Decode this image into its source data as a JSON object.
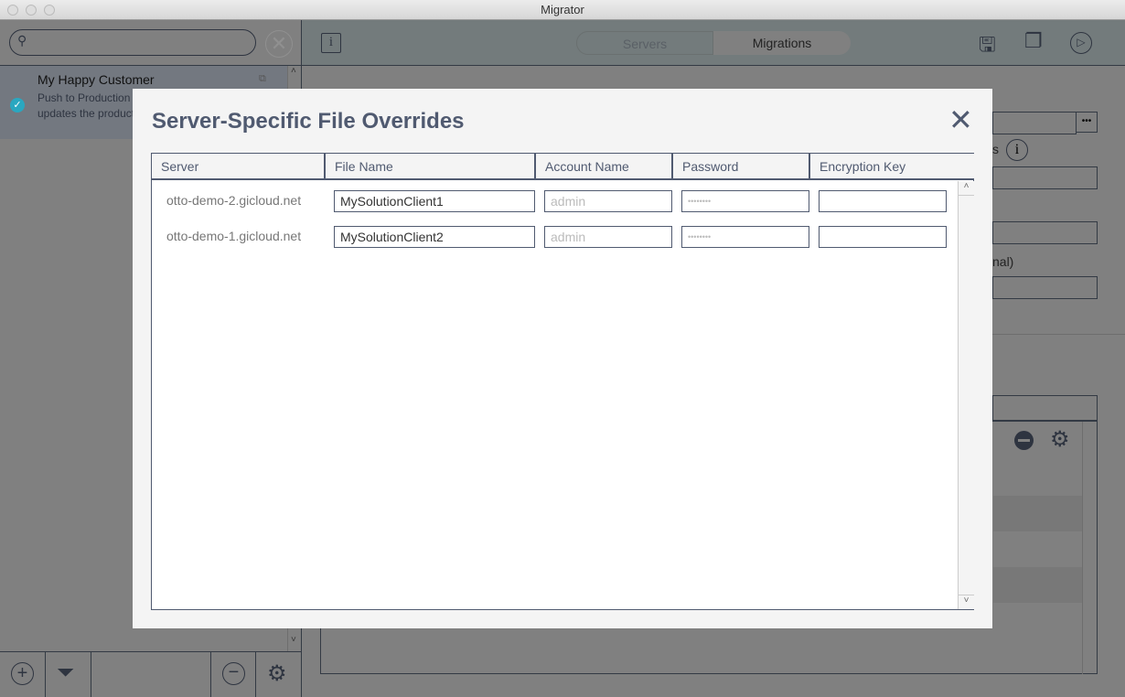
{
  "window": {
    "title": "Migrator"
  },
  "sidebar": {
    "search_placeholder": "",
    "item": {
      "title": "My Happy Customer",
      "line1": "Push to Production",
      "line2": "updates the product"
    }
  },
  "toolbar": {
    "tabs": [
      {
        "label": "Servers",
        "selected": false
      },
      {
        "label": "Migrations",
        "selected": true
      }
    ]
  },
  "background": {
    "optional_label_fragment": "nal)",
    "s_fragment": "s"
  },
  "modal": {
    "title": "Server-Specific File Overrides",
    "columns": [
      "Server",
      "File Name",
      "Account Name",
      "Password",
      "Encryption Key"
    ],
    "rows": [
      {
        "server": "otto-demo-2.gicloud.net",
        "file_name": "MySolutionClient1",
        "account_placeholder": "admin",
        "password_placeholder": "••••••••",
        "encryption_key": ""
      },
      {
        "server": "otto-demo-1.gicloud.net",
        "file_name": "MySolutionClient2",
        "account_placeholder": "admin",
        "password_placeholder": "••••••••",
        "encryption_key": ""
      }
    ]
  },
  "colors": {
    "accent": "#505a70",
    "check": "#2aa7c0"
  }
}
